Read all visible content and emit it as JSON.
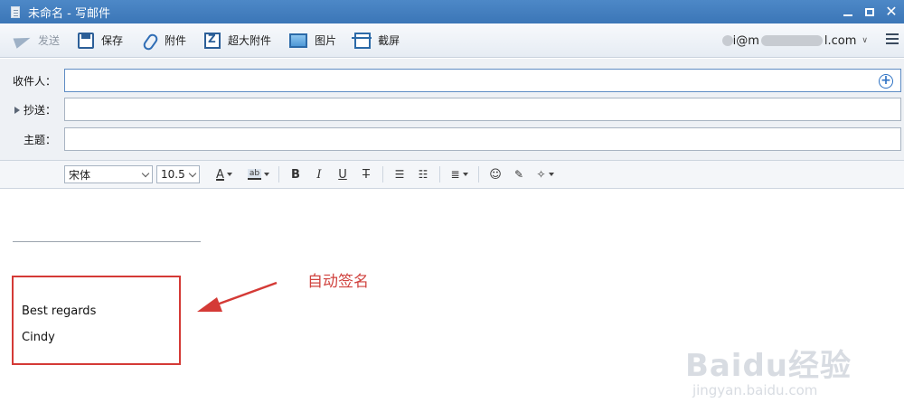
{
  "window": {
    "title": "未命名 - 写邮件"
  },
  "toolbar": {
    "send_label": "发送",
    "save_label": "保存",
    "attach_label": "附件",
    "big_attach_label": "超大附件",
    "image_label": "图片",
    "screenshot_label": "截屏",
    "account_visible_a": "i@m",
    "account_visible_b": "l.com"
  },
  "fields": {
    "to_label": "收件人：",
    "cc_label": "抄送：",
    "subject_label": "主题：",
    "to_value": "",
    "cc_value": "",
    "subject_value": ""
  },
  "format": {
    "font_family": "宋体",
    "font_size": "10.5",
    "bold": "B",
    "italic": "I",
    "underline": "U",
    "strike": "T"
  },
  "body": {
    "signature_line1": "Best regards",
    "signature_line2": "Cindy",
    "annotation": "自动签名"
  },
  "watermark": {
    "brand": "Baidu经验",
    "url": "jingyan.baidu.com"
  },
  "colors": {
    "accent": "#3b76b7",
    "annotation_red": "#d43a36"
  }
}
